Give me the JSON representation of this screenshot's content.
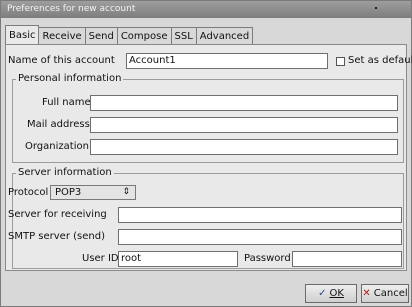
{
  "window": {
    "title": "Preferences for new account"
  },
  "tabs": [
    {
      "label": "Basic",
      "active": true
    },
    {
      "label": "Receive",
      "active": false
    },
    {
      "label": "Send",
      "active": false
    },
    {
      "label": "Compose",
      "active": false
    },
    {
      "label": "SSL",
      "active": false
    },
    {
      "label": "Advanced",
      "active": false
    }
  ],
  "account": {
    "name_label": "Name of this account",
    "name_value": "Account1",
    "default_label": "Set as default",
    "default_checked": false
  },
  "personal": {
    "title": "Personal information",
    "full_name_label": "Full name",
    "full_name_value": "",
    "mail_label": "Mail address",
    "mail_value": "",
    "org_label": "Organization",
    "org_value": ""
  },
  "server": {
    "title": "Server information",
    "protocol_label": "Protocol",
    "protocol_value": "POP3",
    "receiving_label": "Server for receiving",
    "receiving_value": "",
    "smtp_label": "SMTP server (send)",
    "smtp_value": "",
    "userid_label": "User ID",
    "userid_value": "root",
    "password_label": "Password",
    "password_value": ""
  },
  "buttons": {
    "ok_label": "OK",
    "cancel_label": "Cancel",
    "ok_icon": "ok-icon",
    "cancel_icon": "cancel-icon"
  }
}
